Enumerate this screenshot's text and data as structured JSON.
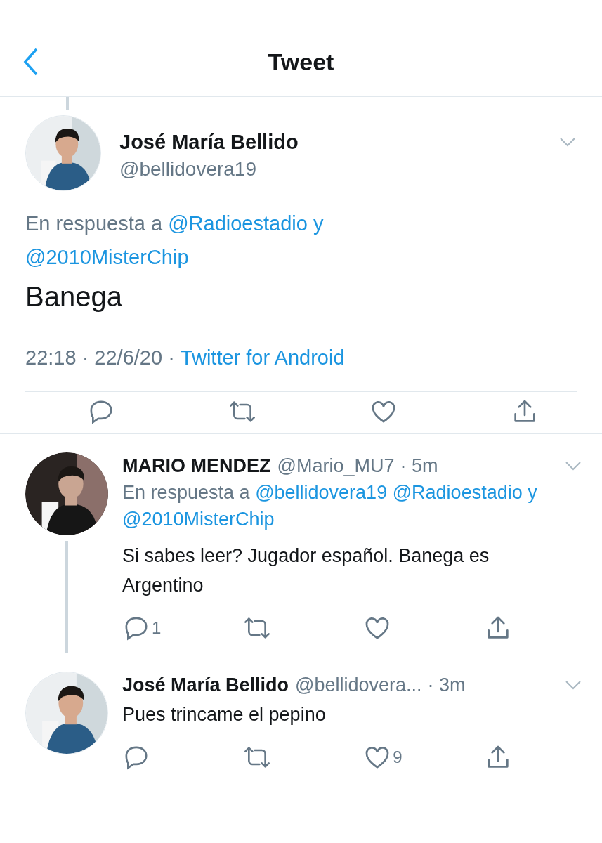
{
  "header": {
    "title": "Tweet"
  },
  "main_tweet": {
    "name": "José María Bellido",
    "handle": "@bellidovera19",
    "reply_prefix": "En respuesta a",
    "mentions": [
      "@Radioestadio y",
      "@2010MisterChip"
    ],
    "text": "Banega",
    "time": "22:18 · 22/6/20 ·",
    "source": "Twitter for Android",
    "actions": [
      {
        "kind": "reply"
      },
      {
        "kind": "retweet"
      },
      {
        "kind": "like"
      },
      {
        "kind": "share"
      }
    ]
  },
  "replies": [
    {
      "name": "MARIO MENDEZ",
      "handle": "@Mario_MU7",
      "age": "· 5m",
      "reply_prefix": "En respuesta a",
      "mentions": [
        "@bellidovera19",
        "@Radioestadio y",
        "@2010MisterChip"
      ],
      "text": "Si sabes leer? Jugador español. Banega es Argentino",
      "thread_below": true,
      "actions": [
        {
          "kind": "reply",
          "count": "1"
        },
        {
          "kind": "retweet"
        },
        {
          "kind": "like"
        },
        {
          "kind": "share"
        }
      ]
    },
    {
      "name": "José María Bellido",
      "handle": "@bellidovera...",
      "age": "· 3m",
      "text": "Pues trincame el pepino",
      "thread_below": false,
      "actions": [
        {
          "kind": "reply"
        },
        {
          "kind": "retweet"
        },
        {
          "kind": "like",
          "count": "9"
        },
        {
          "kind": "share"
        }
      ]
    }
  ]
}
